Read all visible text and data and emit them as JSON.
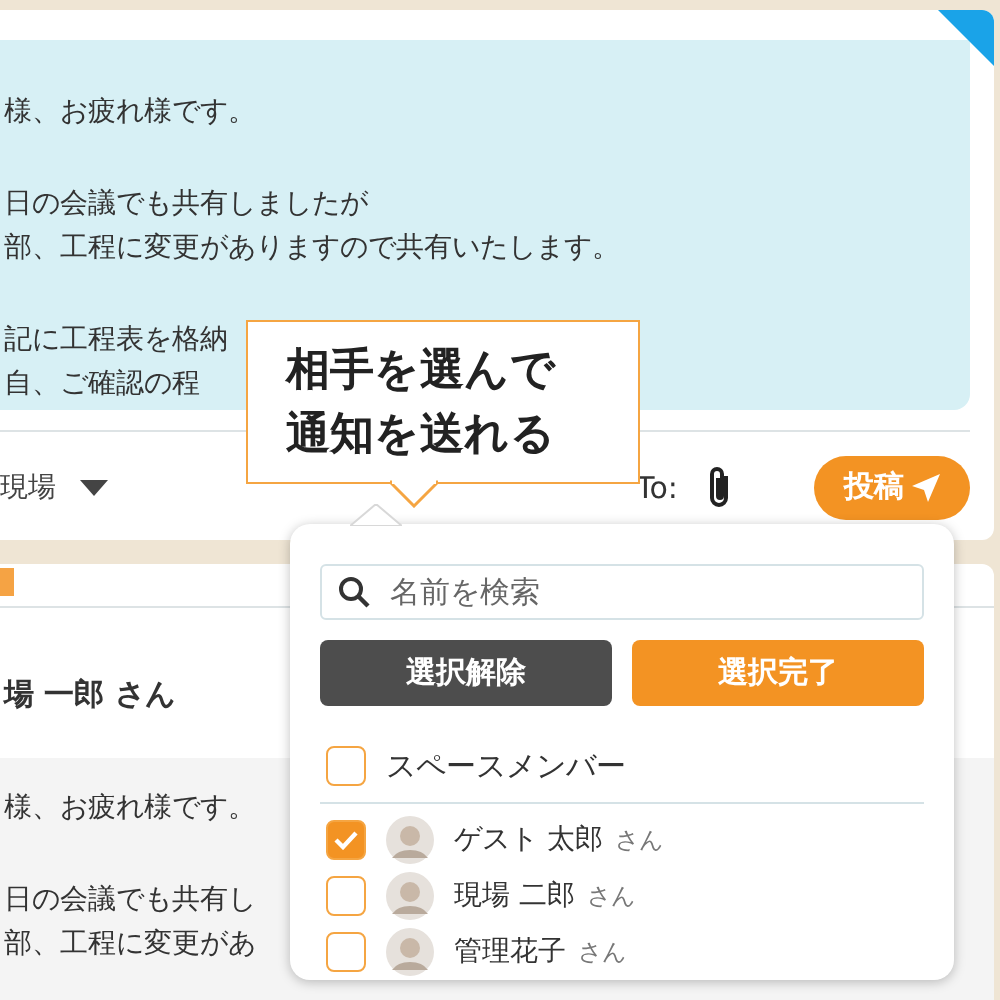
{
  "post": {
    "paragraphs": [
      [
        "様、お疲れ様です。"
      ],
      [
        "日の会議でも共有しましたが",
        "部、工程に変更がありますので共有いたします。"
      ],
      [
        "記に工程表を格納",
        "自、ご確認の程"
      ]
    ],
    "footer": {
      "space": "現場",
      "to_label": "To:",
      "post_button": "投稿"
    }
  },
  "tooltip": {
    "lines": [
      "相手を選んで",
      "通知を送れる"
    ]
  },
  "second_post": {
    "author": "場 一郎",
    "honorific": "さん",
    "paragraphs": [
      [
        "様、お疲れ様です。"
      ],
      [
        "日の会議でも共有し",
        "部、工程に変更があ"
      ]
    ]
  },
  "member_picker": {
    "search": {
      "placeholder": "名前を検索"
    },
    "buttons": [
      {
        "label": "選択解除",
        "kind": "clear"
      },
      {
        "label": "選択完了",
        "kind": "done"
      }
    ],
    "all": {
      "label": "スペースメンバー",
      "checked": false
    },
    "members": [
      {
        "name": "ゲスト 太郎",
        "honorific": "さん",
        "checked": true
      },
      {
        "name": "現場 二郎",
        "honorific": "さん",
        "checked": false
      },
      {
        "name": "管理花子",
        "honorific": "さん",
        "checked": false
      }
    ]
  }
}
